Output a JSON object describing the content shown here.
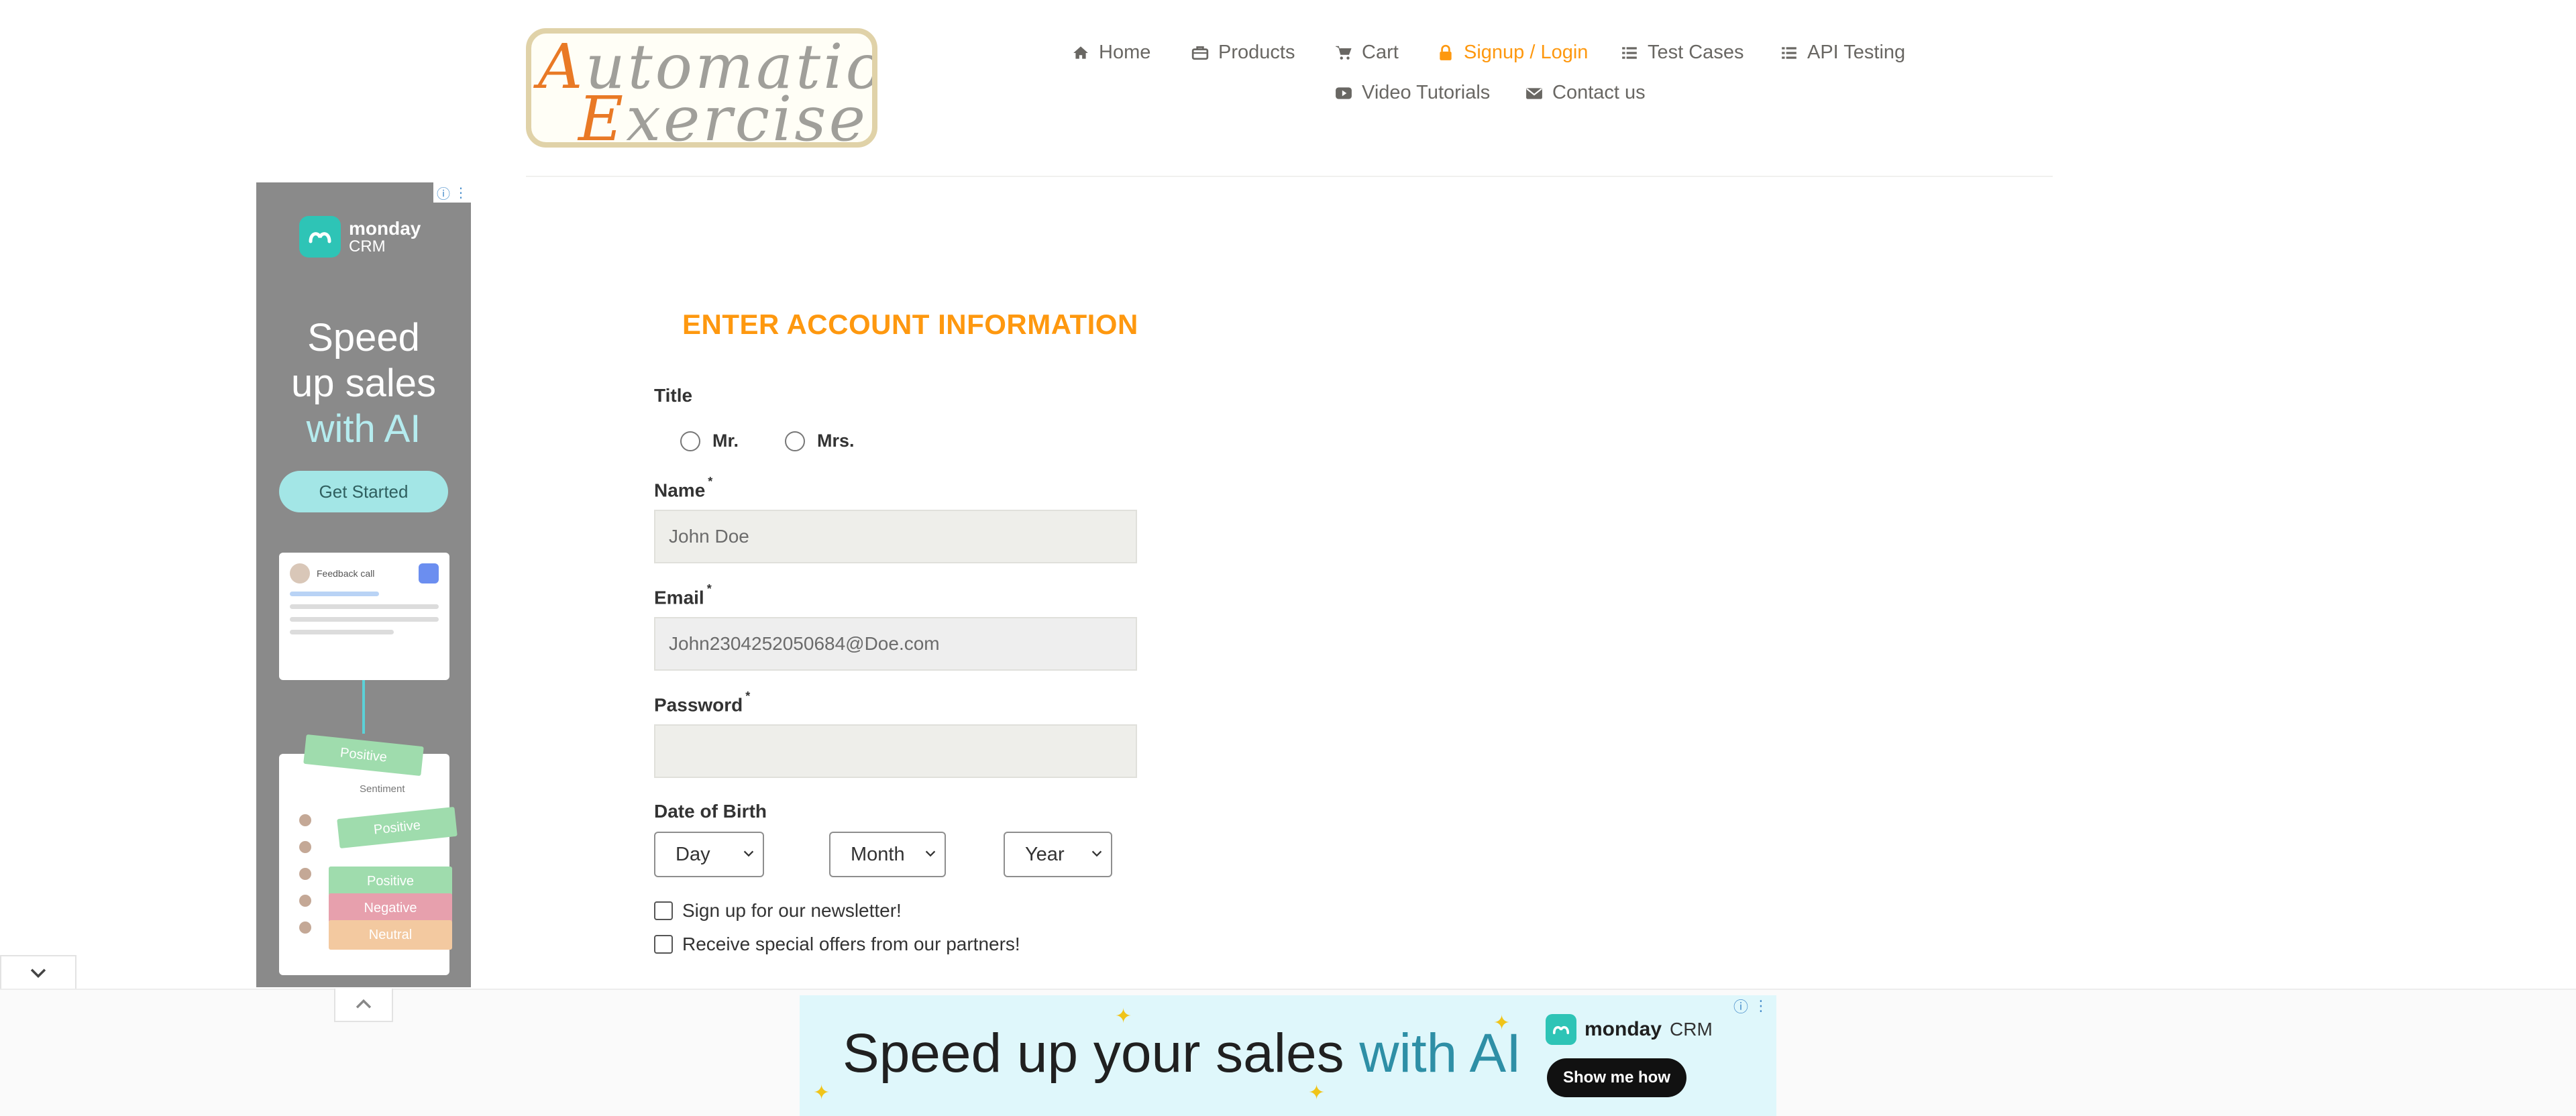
{
  "logo": {
    "line1_cap": "A",
    "line1_rest": "utomation",
    "line2_cap": "E",
    "line2_rest": "xercise"
  },
  "nav": {
    "home": "Home",
    "products": "Products",
    "cart": "Cart",
    "signup_login": "Signup / Login",
    "test_cases": "Test Cases",
    "api_testing": "API Testing",
    "video_tutorials": "Video Tutorials",
    "contact_us": "Contact us",
    "active_color": "#fe980f"
  },
  "form": {
    "heading": "ENTER ACCOUNT INFORMATION",
    "title_label": "Title",
    "title_options": [
      "Mr.",
      "Mrs."
    ],
    "name_label": "Name",
    "name_value": "John Doe",
    "email_label": "Email",
    "email_value": "John2304252050684@Doe.com",
    "password_label": "Password",
    "password_value": "",
    "required_mark": "*",
    "dob_label": "Date of Birth",
    "dob_day": "Day",
    "dob_month": "Month",
    "dob_year": "Year",
    "newsletter_label": "Sign up for our newsletter!",
    "offers_label": "Receive special offers from our partners!"
  },
  "ad_left": {
    "brand_name": "monday",
    "brand_sub": "CRM",
    "headline_1": "Speed",
    "headline_2": "up sales",
    "headline_accent": "with AI",
    "cta": "Get Started",
    "card_title": "Feedback call",
    "tags": [
      "Positive",
      "Positive",
      "Positive",
      "Negative",
      "Neutral"
    ],
    "sheet_header": "Sentiment"
  },
  "ad_bottom": {
    "headline": "Speed up your sales ",
    "headline_accent": "with AI",
    "brand_name": "monday",
    "brand_sub": "CRM",
    "cta": "Show me how"
  }
}
